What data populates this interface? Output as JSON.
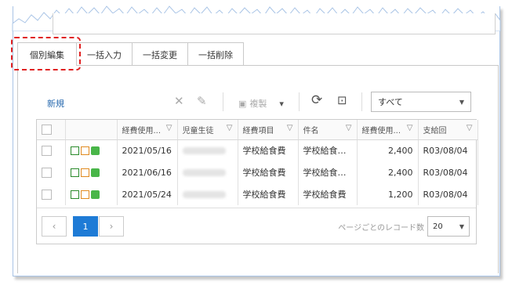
{
  "tabs": [
    {
      "label": "個別編集",
      "active": true
    },
    {
      "label": "一括入力",
      "active": false
    },
    {
      "label": "一括変更",
      "active": false
    },
    {
      "label": "一括削除",
      "active": false
    }
  ],
  "toolbar": {
    "new_label": "新規",
    "copy_label": "複製",
    "filter_value": "すべて"
  },
  "grid": {
    "headers": [
      "経費使用...",
      "児童生徒",
      "経費項目",
      "件名",
      "経費使用...",
      "支給回"
    ],
    "rows": [
      {
        "date": "2021/05/16",
        "item": "学校給食費",
        "subject": "学校給食費...",
        "amount": "2,400",
        "payment": "R03/08/04"
      },
      {
        "date": "2021/06/16",
        "item": "学校給食費",
        "subject": "学校給食費...",
        "amount": "2,400",
        "payment": "R03/08/04"
      },
      {
        "date": "2021/05/24",
        "item": "学校給食費",
        "subject": "学校給食費",
        "amount": "1,200",
        "payment": "R03/08/04"
      }
    ]
  },
  "pager": {
    "current_page": "1",
    "prev_icon": "chevron-left-icon",
    "next_icon": "chevron-right-icon",
    "records_label": "ページごとのレコード数",
    "records_value": "20"
  },
  "colors": {
    "accent": "#1e7bd6",
    "highlight": "#e02020"
  }
}
